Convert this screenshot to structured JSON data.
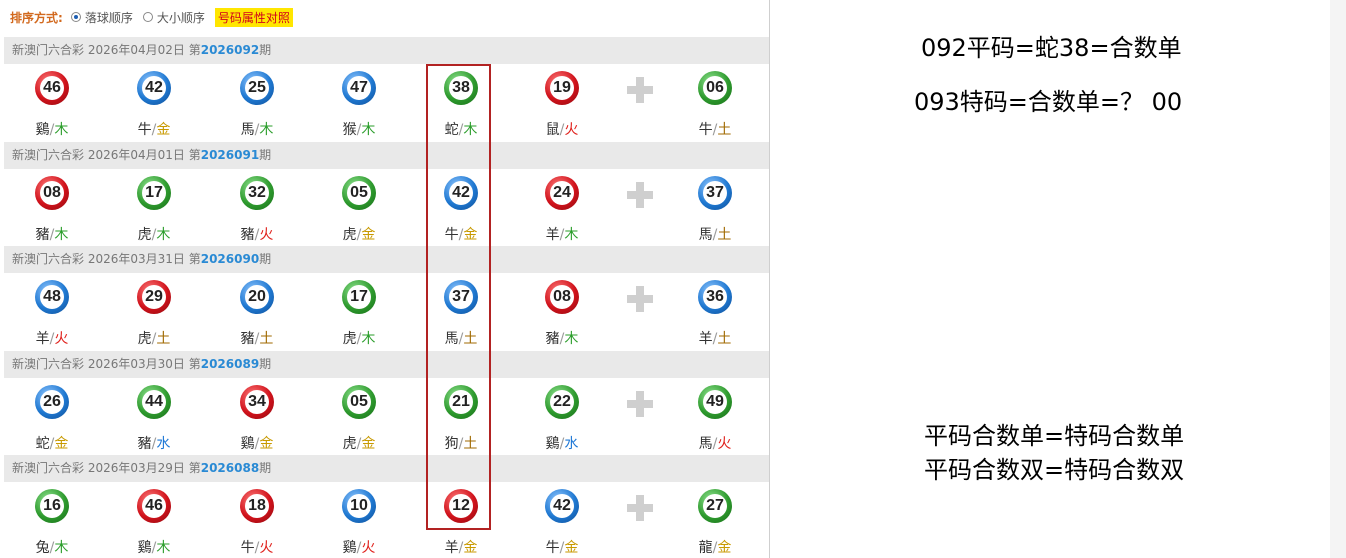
{
  "sort": {
    "label": "排序方式:",
    "option1": "落球顺序",
    "option2": "大小顺序",
    "attr_button": "号码属性对照"
  },
  "sep": "/",
  "draws": [
    {
      "header_prefix": "新澳门六合彩 2026年04月02日 第",
      "draw_no": "2026092",
      "header_suffix": "期",
      "balls": [
        {
          "num": "46",
          "color": "red",
          "zodiac": "鷄",
          "element": "木"
        },
        {
          "num": "42",
          "color": "blue",
          "zodiac": "牛",
          "element": "金"
        },
        {
          "num": "25",
          "color": "blue",
          "zodiac": "馬",
          "element": "木"
        },
        {
          "num": "47",
          "color": "blue",
          "zodiac": "猴",
          "element": "木"
        },
        {
          "num": "38",
          "color": "green",
          "zodiac": "蛇",
          "element": "木"
        },
        {
          "num": "19",
          "color": "red",
          "zodiac": "鼠",
          "element": "火"
        },
        {
          "num": "06",
          "color": "green",
          "zodiac": "牛",
          "element": "土"
        }
      ]
    },
    {
      "header_prefix": "新澳门六合彩 2026年04月01日 第",
      "draw_no": "2026091",
      "header_suffix": "期",
      "balls": [
        {
          "num": "08",
          "color": "red",
          "zodiac": "豬",
          "element": "木"
        },
        {
          "num": "17",
          "color": "green",
          "zodiac": "虎",
          "element": "木"
        },
        {
          "num": "32",
          "color": "green",
          "zodiac": "豬",
          "element": "火"
        },
        {
          "num": "05",
          "color": "green",
          "zodiac": "虎",
          "element": "金"
        },
        {
          "num": "42",
          "color": "blue",
          "zodiac": "牛",
          "element": "金"
        },
        {
          "num": "24",
          "color": "red",
          "zodiac": "羊",
          "element": "木"
        },
        {
          "num": "37",
          "color": "blue",
          "zodiac": "馬",
          "element": "土"
        }
      ]
    },
    {
      "header_prefix": "新澳门六合彩 2026年03月31日 第",
      "draw_no": "2026090",
      "header_suffix": "期",
      "balls": [
        {
          "num": "48",
          "color": "blue",
          "zodiac": "羊",
          "element": "火"
        },
        {
          "num": "29",
          "color": "red",
          "zodiac": "虎",
          "element": "土"
        },
        {
          "num": "20",
          "color": "blue",
          "zodiac": "豬",
          "element": "土"
        },
        {
          "num": "17",
          "color": "green",
          "zodiac": "虎",
          "element": "木"
        },
        {
          "num": "37",
          "color": "blue",
          "zodiac": "馬",
          "element": "土"
        },
        {
          "num": "08",
          "color": "red",
          "zodiac": "豬",
          "element": "木"
        },
        {
          "num": "36",
          "color": "blue",
          "zodiac": "羊",
          "element": "土"
        }
      ]
    },
    {
      "header_prefix": "新澳门六合彩 2026年03月30日 第",
      "draw_no": "2026089",
      "header_suffix": "期",
      "balls": [
        {
          "num": "26",
          "color": "blue",
          "zodiac": "蛇",
          "element": "金"
        },
        {
          "num": "44",
          "color": "green",
          "zodiac": "豬",
          "element": "水"
        },
        {
          "num": "34",
          "color": "red",
          "zodiac": "鷄",
          "element": "金"
        },
        {
          "num": "05",
          "color": "green",
          "zodiac": "虎",
          "element": "金"
        },
        {
          "num": "21",
          "color": "green",
          "zodiac": "狗",
          "element": "土"
        },
        {
          "num": "22",
          "color": "green",
          "zodiac": "鷄",
          "element": "水"
        },
        {
          "num": "49",
          "color": "green",
          "zodiac": "馬",
          "element": "火"
        }
      ]
    },
    {
      "header_prefix": "新澳门六合彩 2026年03月29日 第",
      "draw_no": "2026088",
      "header_suffix": "期",
      "balls": [
        {
          "num": "16",
          "color": "green",
          "zodiac": "兔",
          "element": "木"
        },
        {
          "num": "46",
          "color": "red",
          "zodiac": "鷄",
          "element": "木"
        },
        {
          "num": "18",
          "color": "red",
          "zodiac": "牛",
          "element": "火"
        },
        {
          "num": "10",
          "color": "blue",
          "zodiac": "鷄",
          "element": "火"
        },
        {
          "num": "12",
          "color": "red",
          "zodiac": "羊",
          "element": "金"
        },
        {
          "num": "42",
          "color": "blue",
          "zodiac": "牛",
          "element": "金"
        },
        {
          "num": "27",
          "color": "green",
          "zodiac": "龍",
          "element": "金"
        }
      ]
    }
  ],
  "notes": {
    "line1": "092平码=蛇38=合数单",
    "line2": "093特码=合数单=？ 00",
    "line3": "平码合数单=特码合数单",
    "line4": "平码合数双=特码合数双"
  },
  "colors": {
    "red_ball": "#d0121b",
    "blue_ball": "#1f78d1",
    "green_ball": "#2e9a2e",
    "highlight_border": "#b22222",
    "draw_no": "#2a8ad4",
    "sort_label": "#d2691e",
    "attr_button_bg": "#ffe600"
  },
  "icons": {
    "plus": "plus-icon",
    "radio": "radio-icon"
  }
}
